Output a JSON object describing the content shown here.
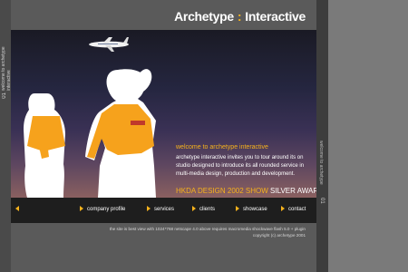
{
  "header": {
    "brand_a": "Archetype",
    "brand_sep": ":",
    "brand_b": "Interactive"
  },
  "left_strip": {
    "vertical_text": "welcome to archetype interactive",
    "number": "01"
  },
  "right_strip": {
    "vertical_text": "welcome to archetype",
    "number": "01"
  },
  "content": {
    "welcome": "welcome to archetype interactive",
    "intro": "archetype interactive invites you to tour around its on studio designed to introduce its all rounded service in multi-media design, production and development.",
    "award_a": "HKDA DESIGN 2002 SHOW",
    "award_b": "SILVER AWARD"
  },
  "nav": {
    "items": [
      {
        "label": "company profile"
      },
      {
        "label": "services"
      },
      {
        "label": "clients"
      },
      {
        "label": "showcase"
      },
      {
        "label": "contact"
      }
    ]
  },
  "footer": {
    "line1": "the site is best view with 1024*768 netscape 4.0 above requires macromedia shockwave flash 5.0 + plugin",
    "line2": "copyright (c) archetype 2001"
  },
  "colors": {
    "accent": "#f6b21c",
    "figure": "#ffffff",
    "shirt": "#f6a21c"
  }
}
